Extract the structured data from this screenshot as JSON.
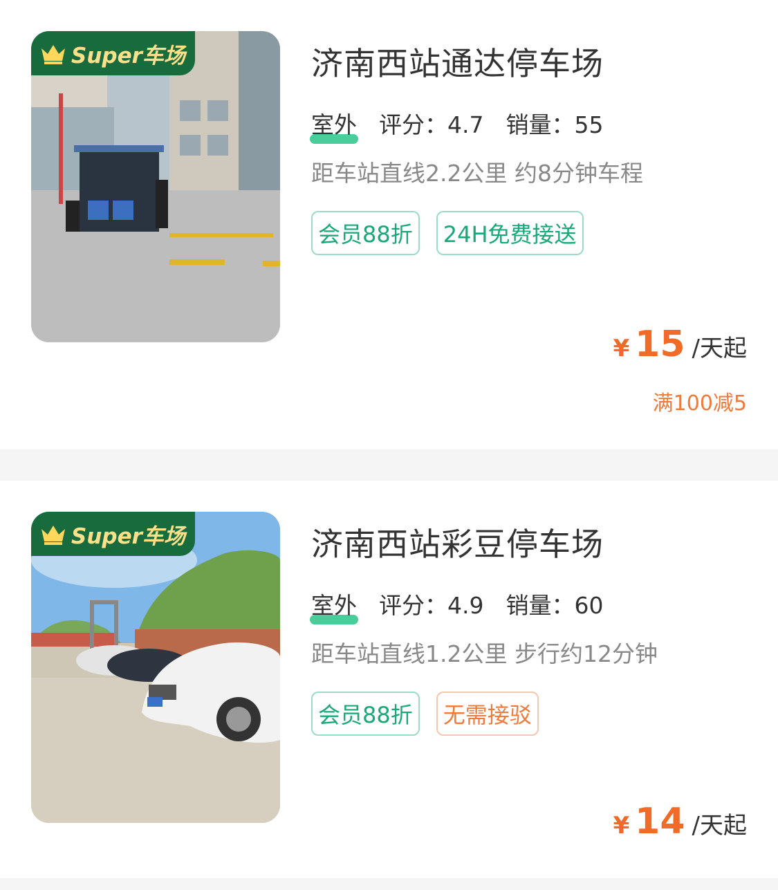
{
  "badge_label": "Super车场",
  "colors": {
    "brand_green": "#176b3d",
    "price_orange": "#f26b26",
    "tag_green": "#19a877"
  },
  "lots": [
    {
      "name": "济南西站通达停车场",
      "location_type": "室外",
      "rating_label": "评分：",
      "rating": "4.7",
      "sales_label": "销量：",
      "sales": "55",
      "distance": "距车站直线2.2公里 约8分钟车程",
      "tags": [
        "会员88折",
        "24H免费接送"
      ],
      "price_symbol": "¥",
      "price": "15",
      "price_unit": "/天起",
      "promo": "满100减5"
    },
    {
      "name": "济南西站彩豆停车场",
      "location_type": "室外",
      "rating_label": "评分：",
      "rating": "4.9",
      "sales_label": "销量：",
      "sales": "60",
      "distance": "距车站直线1.2公里 步行约12分钟",
      "tags": [
        "会员88折",
        "无需接驳"
      ],
      "price_symbol": "¥",
      "price": "14",
      "price_unit": "/天起"
    }
  ]
}
